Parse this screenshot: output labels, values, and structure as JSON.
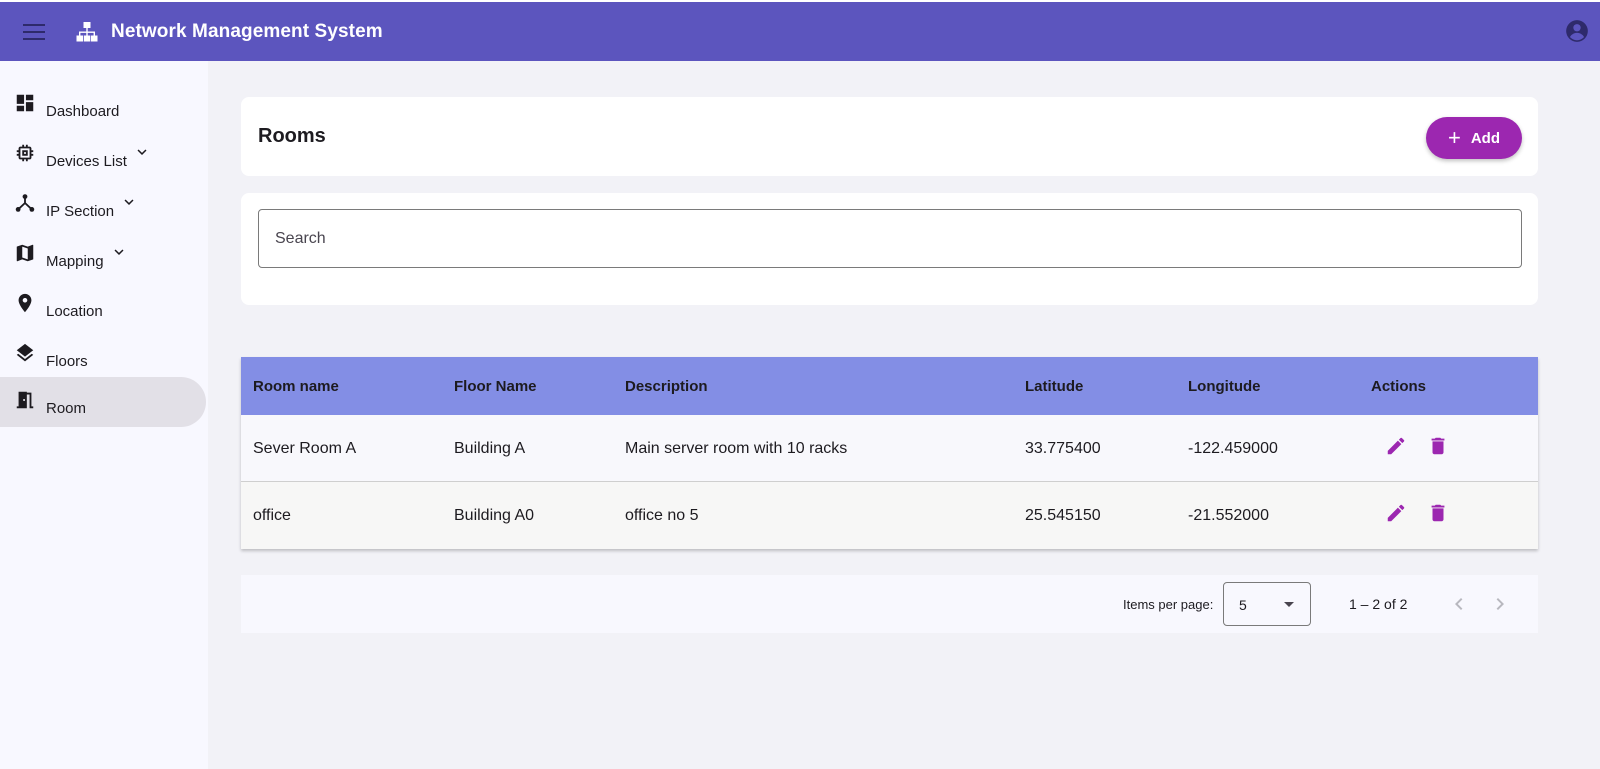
{
  "header": {
    "title": "Network Management System",
    "menu_icon": "menu-icon",
    "brand_icon": "sitemap-icon",
    "account_icon": "account-circle-icon",
    "bg_color": "#5c55be"
  },
  "sidebar": {
    "items": [
      {
        "label": "Dashboard",
        "icon": "dashboard-icon",
        "expandable": false
      },
      {
        "label": "Devices List",
        "icon": "chip-icon",
        "expandable": true
      },
      {
        "label": "IP Section",
        "icon": "hub-icon",
        "expandable": true
      },
      {
        "label": "Mapping",
        "icon": "map-icon",
        "expandable": true
      },
      {
        "label": "Location",
        "icon": "location-pin-icon",
        "expandable": false
      },
      {
        "label": "Floors",
        "icon": "layers-icon",
        "expandable": false
      },
      {
        "label": "Room",
        "icon": "door-icon",
        "expandable": false,
        "active": true
      }
    ]
  },
  "page": {
    "title": "Rooms",
    "add_label": "Add",
    "accent_color": "#9c27b0",
    "search_placeholder": "Search"
  },
  "table": {
    "header_color": "#838ee5",
    "columns": [
      "Room name",
      "Floor Name",
      "Description",
      "Latitude",
      "Longitude",
      "Actions"
    ],
    "rows": [
      {
        "room_name": "Sever Room A",
        "floor_name": "Building A",
        "description": "Main server room with 10 racks",
        "latitude": "33.775400",
        "longitude": "-122.459000"
      },
      {
        "room_name": "office",
        "floor_name": "Building A0",
        "description": "office no 5",
        "latitude": "25.545150",
        "longitude": "-21.552000"
      }
    ]
  },
  "paginator": {
    "items_per_page_label": "Items per page:",
    "items_per_page_value": "5",
    "range_label": "1 – 2 of 2"
  }
}
